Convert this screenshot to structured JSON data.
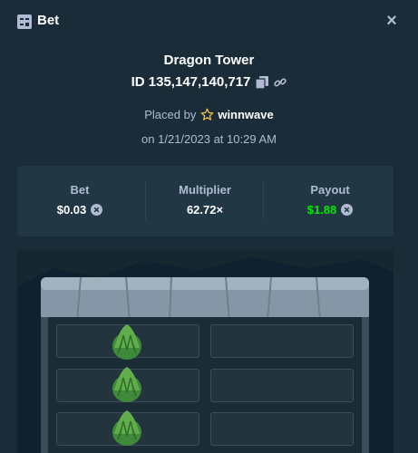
{
  "header": {
    "title": "Bet",
    "icon": "bet-slip-icon",
    "close_icon": "close-icon",
    "close_label": "×"
  },
  "bet": {
    "game": "Dragon Tower",
    "id": "ID 135,147,140,717",
    "placed_by_prefix": "Placed by",
    "username": "winnwave",
    "date": "on 1/21/2023 at 10:29 AM"
  },
  "stats": {
    "bet_label": "Bet",
    "bet_value": "$0.03",
    "multiplier_label": "Multiplier",
    "multiplier_value": "62.72×",
    "payout_label": "Payout",
    "payout_value": "$1.88"
  },
  "colors": {
    "background": "#1a2c38",
    "panel": "#213743",
    "payout": "#00e701",
    "muted": "#b1bad3"
  },
  "tower": {
    "rows_visible": 3,
    "columns": 2,
    "picked_column": 0
  }
}
